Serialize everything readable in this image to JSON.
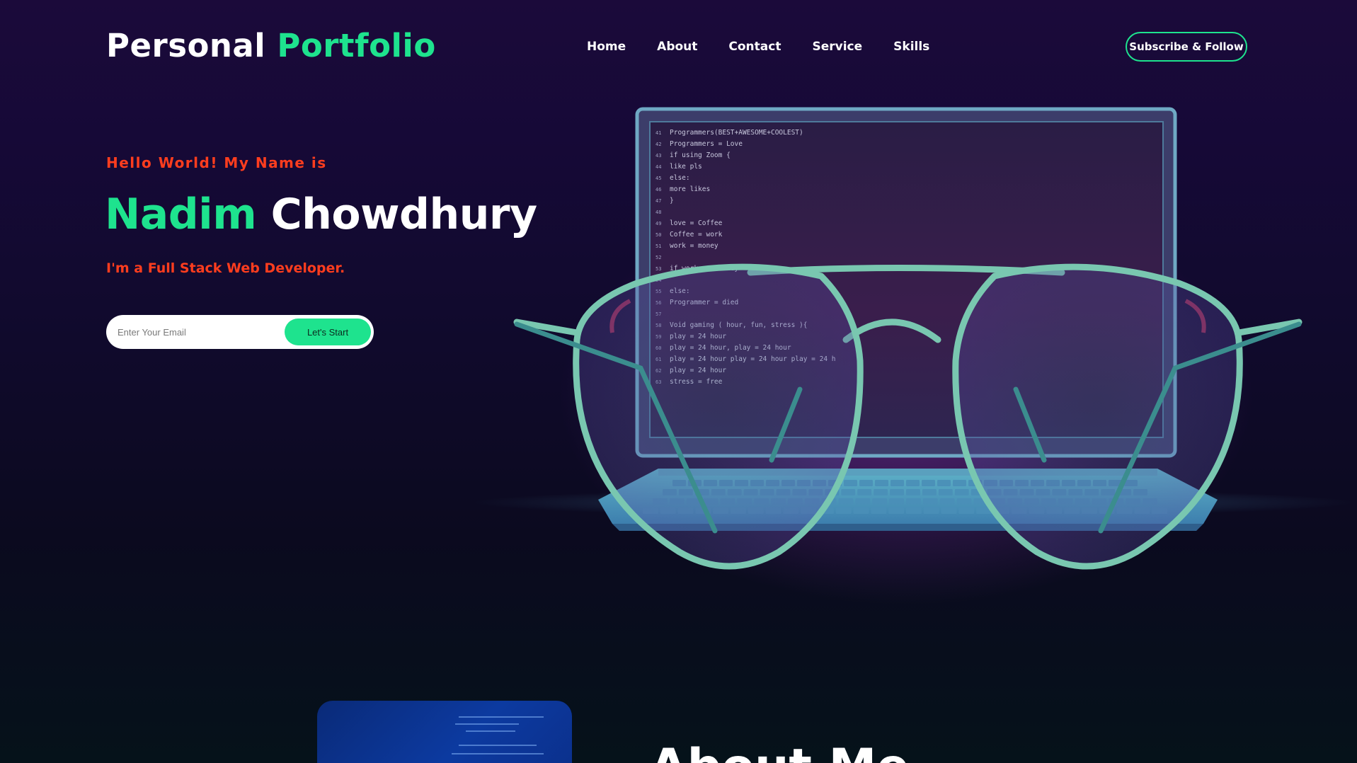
{
  "header": {
    "logo_first": "Personal",
    "logo_second": "Portfolio",
    "nav": [
      "Home",
      "About",
      "Contact",
      "Service",
      "Skills"
    ],
    "cta_label": "Subscribe & Follow"
  },
  "hero": {
    "greeting": "Hello World! My Name is",
    "first_name": "Nadim",
    "last_name": "Chowdhury",
    "role": "I'm a Full Stack Web Developer.",
    "email_placeholder": "Enter Your Email",
    "start_label": "Let's Start"
  },
  "illustration": {
    "description_icon": "laptop-with-glasses-icon",
    "code_lines": [
      "Programmers(BEST+AWESOME+COOLEST)",
      "Programmers = Love",
      "if using Zoom {",
      "   like pls",
      "else:",
      "   more likes",
      "}",
      "",
      "love = Coffee",
      "Coffee = work",
      "work = money",
      "",
      "if work == \"money\" {",
      "",
      "else:",
      "   Programmer = died",
      "",
      "Void gaming ( hour, fun, stress ){",
      "   play = 24 hour",
      "   play = 24 hour, play = 24 hour",
      "   play = 24 hour play = 24 hour play = 24 h",
      "   play = 24 hour",
      "   stress = free"
    ]
  },
  "about": {
    "title": "About Me"
  },
  "colors": {
    "accent_green": "#1ee38e",
    "accent_red": "#ff3d1e",
    "background": "#100a2c"
  }
}
